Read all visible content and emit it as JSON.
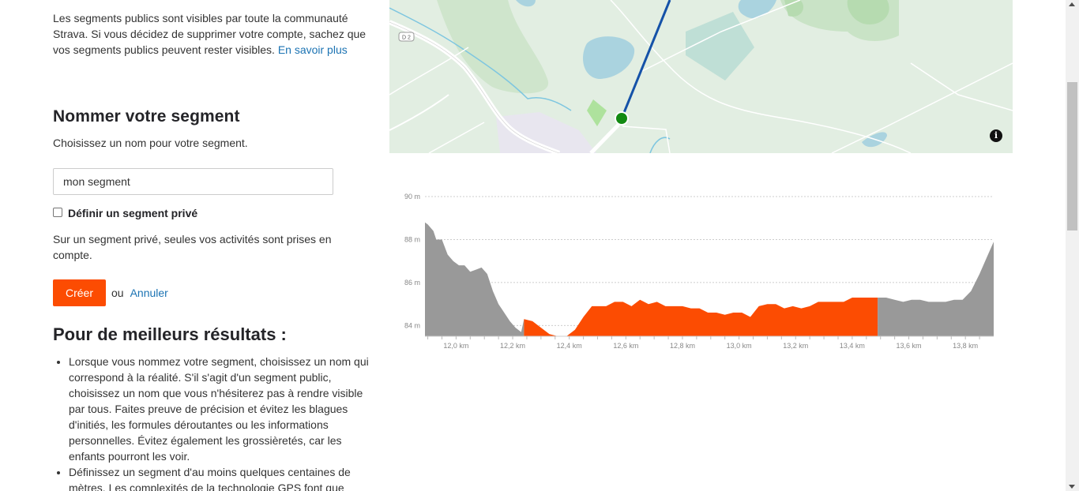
{
  "intro": {
    "text": "Les segments publics sont visibles par toute la communauté Strava. Si vous décidez de supprimer votre compte, sachez que vos segments publics peuvent rester visibles. ",
    "link": "En savoir plus"
  },
  "name_section": {
    "title": "Nommer votre segment",
    "hint": "Choisissez un nom pour votre segment.",
    "input_value": "mon segment",
    "private_label": "Définir un segment privé",
    "private_note": "Sur un segment privé, seules vos activités sont prises en compte."
  },
  "actions": {
    "create": "Créer",
    "or": "ou",
    "cancel": "Annuler"
  },
  "tips": {
    "title": "Pour de meilleurs résultats :",
    "items": [
      "Lorsque vous nommez votre segment, choisissez un nom qui correspond à la réalité. S'il s'agit d'un segment public, choisissez un nom que vous n'hésiterez pas à rendre visible par tous. Faites preuve de précision et évitez les blagues d'initiés, les formules déroutantes ou les informations personnelles. Évitez également les grossièretés, car les enfants pourront les voir.",
      "Définissez un segment d'au moins quelques centaines de mètres. Les complexités de la technologie GPS font que"
    ]
  },
  "map": {
    "road_label": "D 2",
    "info_icon": "info-icon"
  },
  "chart_data": {
    "type": "area",
    "title": "",
    "xlabel": "",
    "ylabel": "",
    "xlim": [
      11.89,
      13.9
    ],
    "ylim": [
      83.5,
      90
    ],
    "x_ticks": [
      "12,0 km",
      "12,2 km",
      "12,4 km",
      "12,6 km",
      "12,8 km",
      "13,0 km",
      "13,2 km",
      "13,4 km",
      "13,6 km",
      "13,8 km"
    ],
    "x_tick_values": [
      12.0,
      12.2,
      12.4,
      12.6,
      12.8,
      13.0,
      13.2,
      13.4,
      13.6,
      13.8
    ],
    "y_ticks": [
      "90 m",
      "88 m",
      "86 m",
      "84 m"
    ],
    "y_tick_values": [
      90,
      88,
      86,
      84
    ],
    "grid": true,
    "segment_start_km": 12.24,
    "segment_end_km": 13.49,
    "colors": {
      "outside": "#999999",
      "segment": "#fc4c02"
    },
    "x": [
      11.89,
      11.9,
      11.92,
      11.93,
      11.95,
      11.97,
      11.99,
      12.01,
      12.03,
      12.05,
      12.07,
      12.09,
      12.11,
      12.13,
      12.15,
      12.17,
      12.19,
      12.21,
      12.23,
      12.24,
      12.27,
      12.3,
      12.33,
      12.36,
      12.39,
      12.42,
      12.45,
      12.48,
      12.5,
      12.53,
      12.56,
      12.59,
      12.62,
      12.65,
      12.68,
      12.71,
      12.74,
      12.77,
      12.8,
      12.83,
      12.86,
      12.89,
      12.92,
      12.95,
      12.98,
      13.01,
      13.04,
      13.07,
      13.1,
      13.13,
      13.16,
      13.19,
      13.22,
      13.25,
      13.28,
      13.31,
      13.34,
      13.37,
      13.4,
      13.43,
      13.46,
      13.49,
      13.52,
      13.55,
      13.58,
      13.61,
      13.64,
      13.67,
      13.7,
      13.73,
      13.76,
      13.79,
      13.82,
      13.85,
      13.88,
      13.9
    ],
    "y": [
      88.8,
      88.7,
      88.4,
      88.0,
      88.0,
      87.3,
      87.0,
      86.8,
      86.8,
      86.5,
      86.6,
      86.7,
      86.4,
      85.6,
      85.0,
      84.6,
      84.2,
      83.9,
      83.7,
      84.3,
      84.2,
      83.9,
      83.6,
      83.5,
      83.5,
      83.8,
      84.4,
      84.9,
      84.9,
      84.9,
      85.1,
      85.1,
      84.9,
      85.2,
      85.0,
      85.1,
      84.9,
      84.9,
      84.9,
      84.8,
      84.8,
      84.6,
      84.6,
      84.5,
      84.6,
      84.6,
      84.4,
      84.9,
      85.0,
      85.0,
      84.8,
      84.9,
      84.8,
      84.9,
      85.1,
      85.1,
      85.1,
      85.1,
      85.3,
      85.3,
      85.3,
      85.3,
      85.3,
      85.2,
      85.1,
      85.2,
      85.2,
      85.1,
      85.1,
      85.1,
      85.2,
      85.2,
      85.6,
      86.4,
      87.3,
      87.9
    ]
  }
}
